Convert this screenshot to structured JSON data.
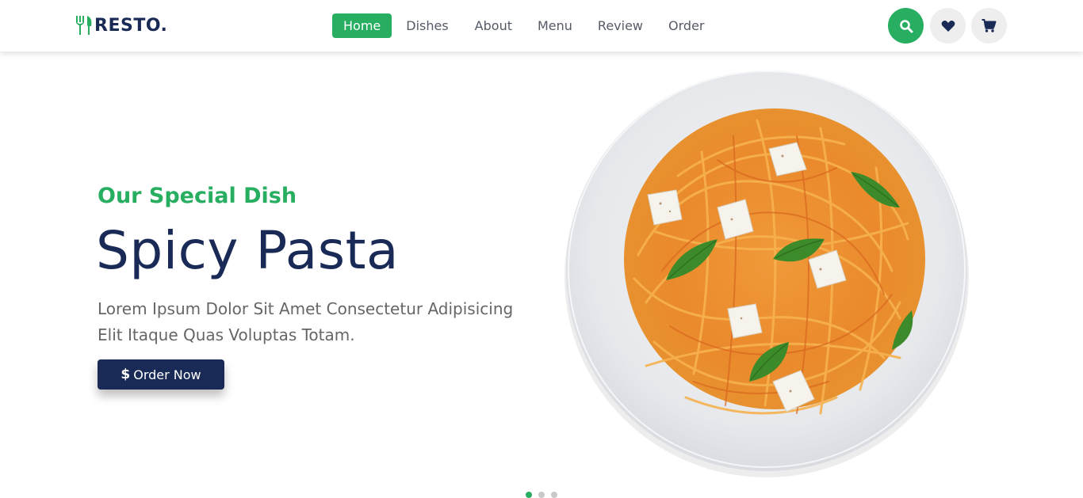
{
  "header": {
    "logo_text": "RESTO.",
    "nav": [
      {
        "label": "Home",
        "active": true
      },
      {
        "label": "Dishes",
        "active": false
      },
      {
        "label": "About",
        "active": false
      },
      {
        "label": "Menu",
        "active": false
      },
      {
        "label": "Review",
        "active": false
      },
      {
        "label": "Order",
        "active": false
      }
    ],
    "icons": [
      "search-icon",
      "heart-icon",
      "cart-icon"
    ]
  },
  "hero": {
    "subtitle": "Our Special Dish",
    "title": "Spicy Pasta",
    "description": "Lorem Ipsum Dolor Sit Amet Consectetur Adipisicing Elit Itaque Quas Voluptas Totam.",
    "button_label": "Order Now",
    "button_icon": "$"
  },
  "slider": {
    "total": 3,
    "active_index": 0
  },
  "colors": {
    "accent": "#27ae60",
    "primary": "#192a56",
    "text": "#666666",
    "nav_text": "#555b66",
    "icon_bg": "#eeeeee"
  }
}
